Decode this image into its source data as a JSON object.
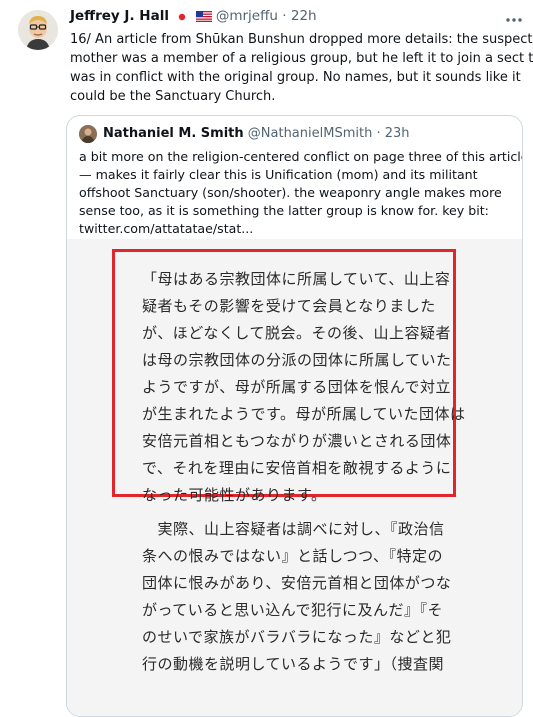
{
  "tweet": {
    "name": "Jeffrey J. Hall",
    "handle": "@mrjeffu",
    "time": "22h",
    "more_icon": "more-icon",
    "text_lines": [
      "16/ An article from Shūkan Bunshun dropped more details:  the suspect's",
      "mother was a member of a religious group, but he left it to join a sect that",
      "was in conflict with the original group. No names, but it sounds like it",
      "could be the Sanctuary Church."
    ]
  },
  "quote": {
    "name": "Nathaniel M. Smith",
    "handle": "@NathanielMSmith",
    "time": "23h",
    "text_lines": [
      "a bit more on the religion-centered conflict on page three of this article",
      "— makes it fairly clear this is Unification (mom) and its militant",
      "offshoot Sanctuary (son/shooter). the weaponry angle makes more",
      "sense too, as it is something the latter group is know for. key bit:",
      "twitter.com/attatatae/stat..."
    ],
    "article": {
      "highlight_lines": [
        "「母はある宗教団体に所属していて、山上容",
        "疑者もその影響を受けて会員となりました",
        "が、ほどなくして脱会。その後、山上容疑者",
        "は母の宗教団体の分派の団体に所属していた",
        "ようですが、母が所属する団体を恨んで対立",
        "が生まれたようです。母が所属していた団体は",
        "安倍元首相ともつながりが濃いとされる団体",
        "で、それを理由に安倍首相を敵視するように",
        "なった可能性があります。"
      ],
      "continuation_lines": [
        "　実際、山上容疑者は調べに対し、『政治信",
        "条への恨みではない』と話しつつ、『特定の",
        "団体に恨みがあり、安倍元首相と団体がつな",
        "がっていると思い込んで犯行に及んだ』『そ",
        "のせいで家族がバラバラになった』などと犯",
        "行の動機を説明しているようです」（捜査関"
      ]
    }
  },
  "colors": {
    "highlight_border": "#e0262b",
    "meta_text": "#536471",
    "quote_border": "#cfd9de"
  }
}
